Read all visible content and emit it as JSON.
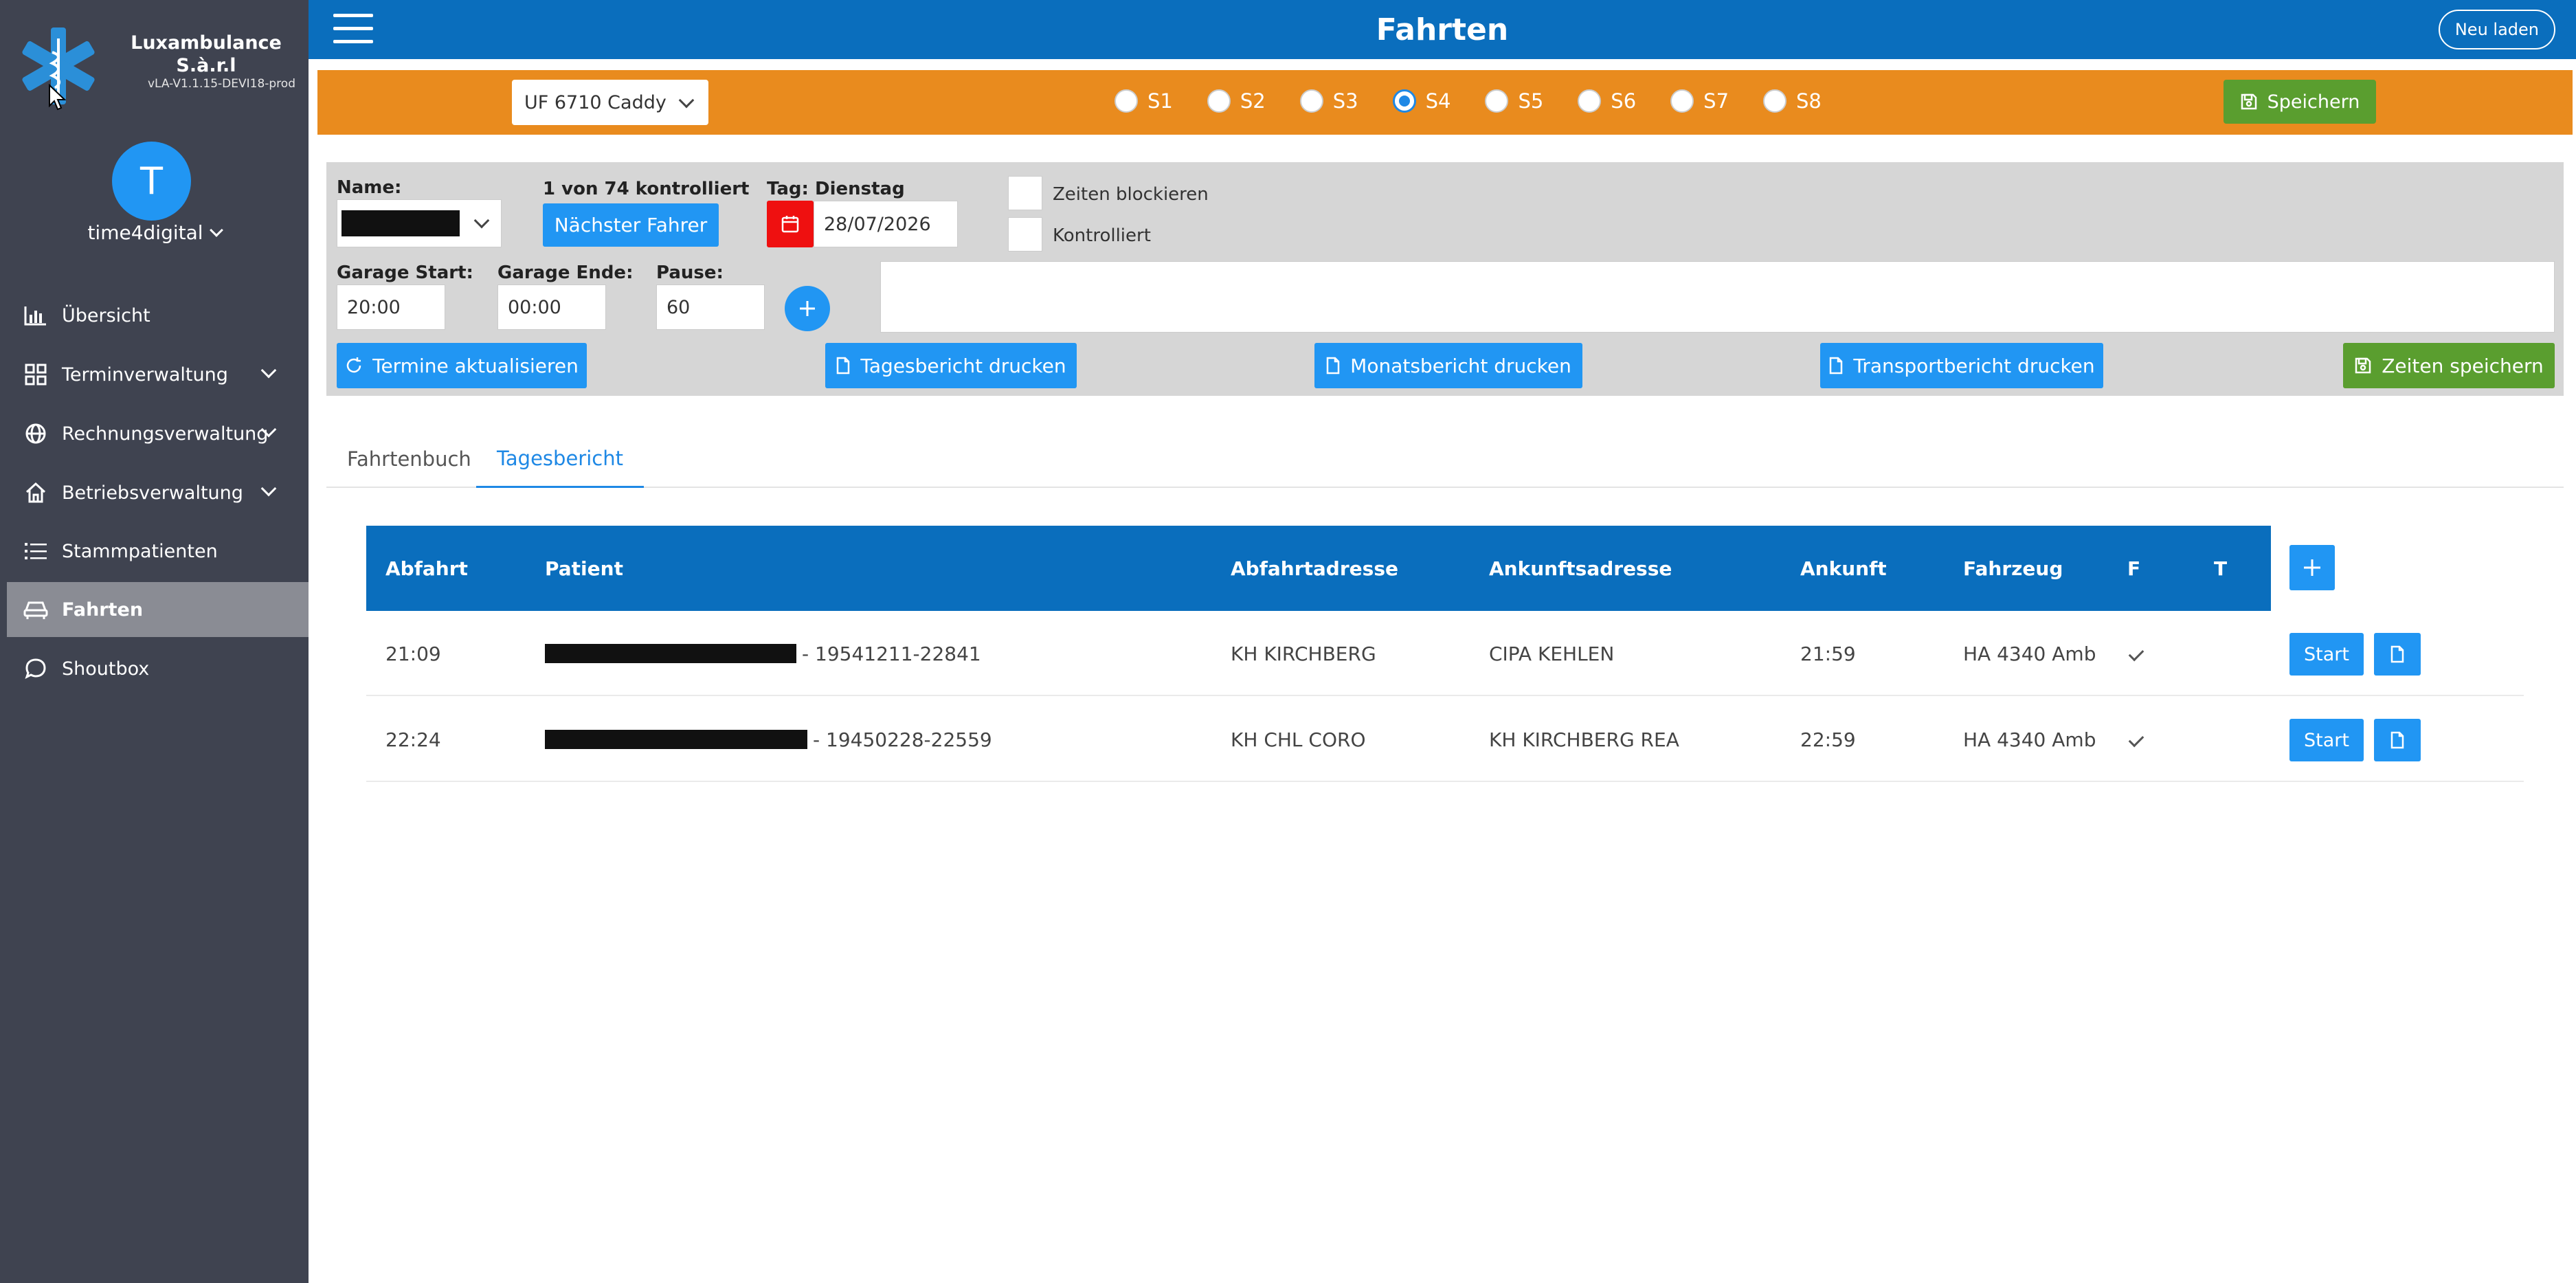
{
  "app": {
    "brand": "Luxambulance S.à.r.l",
    "version": "vLA-V1.1.15-DEVI18-prod",
    "avatar_letter": "T",
    "username": "time4digital",
    "accent_color": "#0a6ebd",
    "sidebar_color": "#3f4350"
  },
  "sidebar": {
    "items": [
      {
        "label": "Übersicht",
        "icon": "bar-chart-icon"
      },
      {
        "label": "Terminverwaltung",
        "icon": "grid-icon"
      },
      {
        "label": "Rechnungsverwaltung",
        "icon": "globe-icon"
      },
      {
        "label": "Betriebsverwaltung",
        "icon": "home-icon"
      },
      {
        "label": "Stammpatienten",
        "icon": "list-icon"
      },
      {
        "label": "Fahrten",
        "icon": "car-icon"
      },
      {
        "label": "Shoutbox",
        "icon": "chat-icon"
      }
    ]
  },
  "header": {
    "title": "Fahrten",
    "reload_label": "Neu laden"
  },
  "toolbar": {
    "vehicle": "UF 6710 Caddy",
    "shifts": [
      "S1",
      "S2",
      "S3",
      "S4",
      "S5",
      "S6",
      "S7",
      "S8"
    ],
    "selected_shift": "S4",
    "save_label": "Speichern"
  },
  "form": {
    "name_label": "Name:",
    "controlled_text": "1 von 74 kontrolliert",
    "next_driver_label": "Nächster Fahrer",
    "day_label": "Tag: Dienstag",
    "date": "28/07/2026",
    "block_times_label": "Zeiten blockieren",
    "controlled_label": "Kontrolliert",
    "garage_start_label": "Garage Start:",
    "garage_start": "20:00",
    "garage_end_label": "Garage Ende:",
    "garage_end": "00:00",
    "pause_label": "Pause:",
    "pause": "60",
    "refresh_label": "Termine aktualisieren",
    "daily_report_label": "Tagesbericht drucken",
    "monthly_report_label": "Monatsbericht drucken",
    "transport_report_label": "Transportbericht drucken",
    "save_times_label": "Zeiten speichern"
  },
  "tabs": [
    {
      "label": "Fahrtenbuch"
    },
    {
      "label": "Tagesbericht"
    }
  ],
  "table": {
    "headers": [
      "Abfahrt",
      "Patient",
      "Abfahrtadresse",
      "Ankunftsadresse",
      "Ankunft",
      "Fahrzeug",
      "F",
      "T"
    ],
    "start_label": "Start",
    "rows": [
      {
        "abfahrt": "21:09",
        "patient_suffix": "- 19541211-22841",
        "from": "KH KIRCHBERG",
        "to": "CIPA KEHLEN",
        "ankunft": "21:59",
        "vehicle": "HA 4340 Amb"
      },
      {
        "abfahrt": "22:24",
        "patient_suffix": "- 19450228-22559",
        "from": "KH CHL CORO",
        "to": "KH KIRCHBERG REA",
        "ankunft": "22:59",
        "vehicle": "HA 4340 Amb"
      }
    ]
  }
}
